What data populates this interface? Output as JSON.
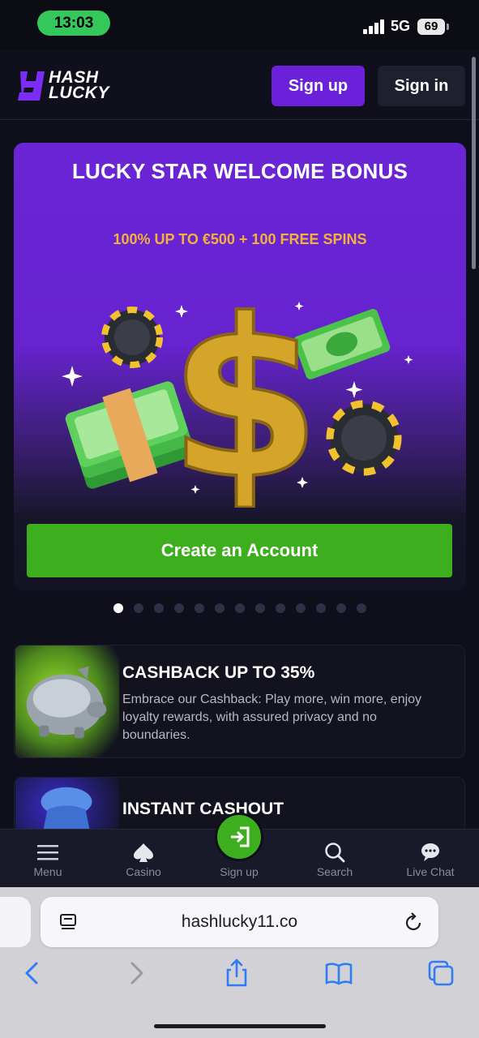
{
  "status": {
    "time": "13:03",
    "network": "5G",
    "battery": "69"
  },
  "header": {
    "logo_top": "HASH",
    "logo_bottom": "LUCKY",
    "signup": "Sign up",
    "signin": "Sign in"
  },
  "hero": {
    "title": "LUCKY STAR WELCOME BONUS",
    "subtitle": "100% UP TO €500 + 100 FREE SPINS",
    "cta": "Create an Account",
    "slide_count": 13,
    "active_slide": 1
  },
  "cards": [
    {
      "title": "CASHBACK UP TO 35%",
      "description": "Embrace our Cashback: Play more, win more, enjoy loyalty rewards, with assured privacy and no boundaries."
    },
    {
      "title": "INSTANT CASHOUT"
    }
  ],
  "bottom_nav": [
    {
      "label": "Menu",
      "icon": "menu-icon"
    },
    {
      "label": "Casino",
      "icon": "spade-icon"
    },
    {
      "label": "Sign up",
      "icon": "login-icon"
    },
    {
      "label": "Search",
      "icon": "search-icon"
    },
    {
      "label": "Live Chat",
      "icon": "chat-icon"
    }
  ],
  "browser": {
    "url": "hashlucky11.co"
  },
  "colors": {
    "brand_purple": "#6a21d9",
    "cta_green": "#3dae1d",
    "accent_gold": "#f4b23a"
  }
}
